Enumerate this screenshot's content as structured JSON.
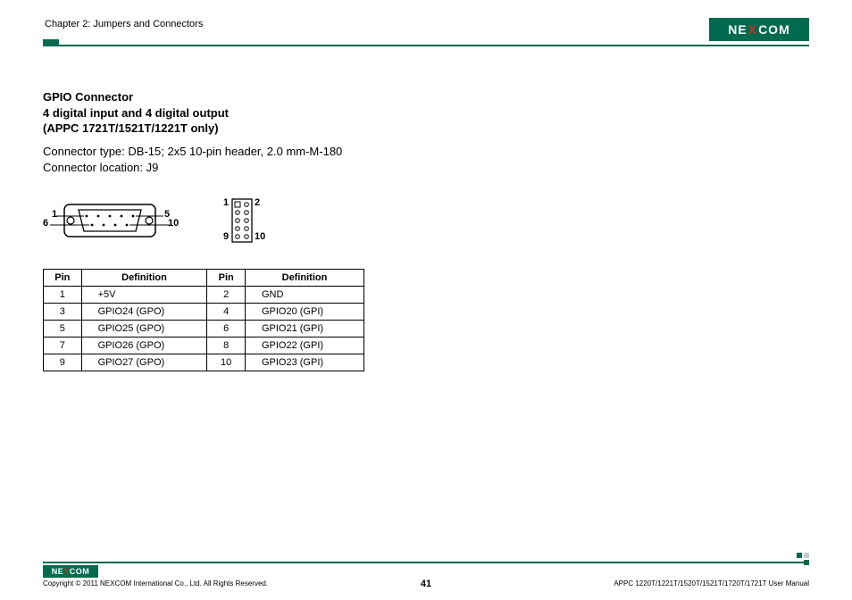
{
  "header": {
    "chapter": "Chapter 2: Jumpers and Connectors",
    "logo_text_1": "NE",
    "logo_text_x": "X",
    "logo_text_2": "COM"
  },
  "section": {
    "title_l1": "GPIO Connector",
    "title_l2": "4 digital input and 4 digital output",
    "title_l3": "(APPC 1721T/1521T/1221T only)",
    "desc_l1": "Connector type: DB-15; 2x5 10-pin header, 2.0 mm-M-180",
    "desc_l2": "Connector location: J9"
  },
  "db15_labels": {
    "p1": "1",
    "p5": "5",
    "p6": "6",
    "p10": "10"
  },
  "pinheader_labels": {
    "p1": "1",
    "p2": "2",
    "p9": "9",
    "p10": "10"
  },
  "table": {
    "headers": [
      "Pin",
      "Definition",
      "Pin",
      "Definition"
    ],
    "rows": [
      {
        "pin_a": "1",
        "def_a": "+5V",
        "pin_b": "2",
        "def_b": "GND"
      },
      {
        "pin_a": "3",
        "def_a": "GPIO24 (GPO)",
        "pin_b": "4",
        "def_b": "GPIO20 (GPI)"
      },
      {
        "pin_a": "5",
        "def_a": "GPIO25 (GPO)",
        "pin_b": "6",
        "def_b": "GPIO21 (GPI)"
      },
      {
        "pin_a": "7",
        "def_a": "GPIO26 (GPO)",
        "pin_b": "8",
        "def_b": "GPIO22 (GPI)"
      },
      {
        "pin_a": "9",
        "def_a": "GPIO27 (GPO)",
        "pin_b": "10",
        "def_b": "GPIO23 (GPI)"
      }
    ]
  },
  "footer": {
    "copyright": "Copyright © 2011 NEXCOM International Co., Ltd. All Rights Reserved.",
    "page": "41",
    "manual": "APPC 1220T/1221T/1520T/1521T/1720T/1721T User Manual"
  }
}
